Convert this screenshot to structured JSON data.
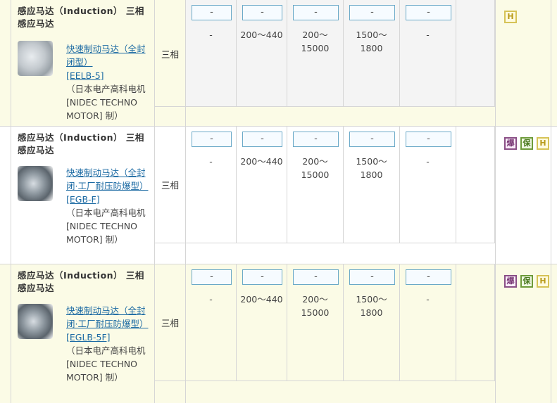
{
  "rows": [
    {
      "product_title": "感应马达（Induction） 三相感应马达",
      "link_name": "快速制动马达（全封闭型）",
      "link_code": "[EELB-5]",
      "maker": "（日本电产高科电机 [NIDEC TECHNO MOTOR] 制）",
      "phase": "三相",
      "selects": [
        "-",
        "-",
        "-",
        "-",
        "-"
      ],
      "values": [
        "-",
        "200～440",
        "200～\n15000",
        "1500～\n1800",
        "-"
      ],
      "icons": [
        {
          "label": "H",
          "name": "h-icon"
        }
      ]
    },
    {
      "product_title": "感应马达（Induction） 三相感应马达",
      "link_name": "快速制动马达（全封闭·工厂耐压防爆型）",
      "link_code": "[EGB-F]",
      "maker": "（日本电产高科电机 [NIDEC TECHNO MOTOR] 制）",
      "phase": "三相",
      "selects": [
        "-",
        "-",
        "-",
        "-",
        "-"
      ],
      "values": [
        "-",
        "200～440",
        "200～\n15000",
        "1500～\n1800",
        "-"
      ],
      "icons": [
        {
          "label": "爆",
          "name": "explosion-proof-icon"
        },
        {
          "label": "保",
          "name": "protection-icon"
        },
        {
          "label": "H",
          "name": "h-icon"
        }
      ]
    },
    {
      "product_title": "感应马达（Induction） 三相感应马达",
      "link_name": "快速制动马达（全封闭·工厂耐压防爆型）",
      "link_code": "[EGLB-5F]",
      "maker": "（日本电产高科电机 [NIDEC TECHNO MOTOR] 制）",
      "phase": "三相",
      "selects": [
        "-",
        "-",
        "-",
        "-",
        "-"
      ],
      "values": [
        "-",
        "200～440",
        "200～\n15000",
        "1500～\n1800",
        "-"
      ],
      "icons": [
        {
          "label": "爆",
          "name": "explosion-proof-icon"
        },
        {
          "label": "保",
          "name": "protection-icon"
        },
        {
          "label": "H",
          "name": "h-icon"
        }
      ]
    }
  ]
}
